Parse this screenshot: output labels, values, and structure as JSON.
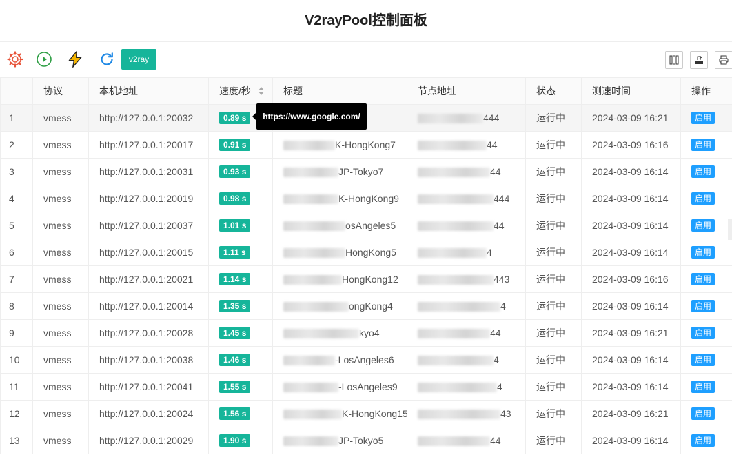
{
  "page_title": "V2rayPool控制面板",
  "toolbar": {
    "icons": [
      "gear-icon",
      "play-icon",
      "lightning-icon",
      "refresh-icon"
    ],
    "v2ray_label": "v2ray",
    "right_icons": [
      "columns-icon",
      "export-icon",
      "print-icon"
    ]
  },
  "table": {
    "headers": {
      "index": "",
      "protocol": "协议",
      "local_address": "本机地址",
      "speed": "速度/秒",
      "title": "标题",
      "node_address": "节点地址",
      "status": "状态",
      "test_time": "测速时间",
      "action": "操作"
    },
    "rows": [
      {
        "index": "1",
        "protocol": "vmess",
        "local": "http://127.0.0.1:20032",
        "speed": "0.89 s",
        "title_tail": "",
        "node_tail": "444",
        "status": "运行中",
        "time": "2024-03-09 16:21",
        "action": "启用"
      },
      {
        "index": "2",
        "protocol": "vmess",
        "local": "http://127.0.0.1:20017",
        "speed": "0.91 s",
        "title_tail": "K-HongKong7",
        "node_tail": "44",
        "status": "运行中",
        "time": "2024-03-09 16:16",
        "action": "启用"
      },
      {
        "index": "3",
        "protocol": "vmess",
        "local": "http://127.0.0.1:20031",
        "speed": "0.93 s",
        "title_tail": "JP-Tokyo7",
        "node_tail": "44",
        "status": "运行中",
        "time": "2024-03-09 16:14",
        "action": "启用"
      },
      {
        "index": "4",
        "protocol": "vmess",
        "local": "http://127.0.0.1:20019",
        "speed": "0.98 s",
        "title_tail": "K-HongKong9",
        "node_tail": "444",
        "status": "运行中",
        "time": "2024-03-09 16:14",
        "action": "启用"
      },
      {
        "index": "5",
        "protocol": "vmess",
        "local": "http://127.0.0.1:20037",
        "speed": "1.01 s",
        "title_tail": "osAngeles5",
        "node_tail": "44",
        "status": "运行中",
        "time": "2024-03-09 16:14",
        "action": "启用"
      },
      {
        "index": "6",
        "protocol": "vmess",
        "local": "http://127.0.0.1:20015",
        "speed": "1.11 s",
        "title_tail": "HongKong5",
        "node_tail": "4",
        "status": "运行中",
        "time": "2024-03-09 16:14",
        "action": "启用"
      },
      {
        "index": "7",
        "protocol": "vmess",
        "local": "http://127.0.0.1:20021",
        "speed": "1.14 s",
        "title_tail": "HongKong12",
        "node_tail": "443",
        "status": "运行中",
        "time": "2024-03-09 16:16",
        "action": "启用"
      },
      {
        "index": "8",
        "protocol": "vmess",
        "local": "http://127.0.0.1:20014",
        "speed": "1.35 s",
        "title_tail": "ongKong4",
        "node_tail": "4",
        "status": "运行中",
        "time": "2024-03-09 16:14",
        "action": "启用"
      },
      {
        "index": "9",
        "protocol": "vmess",
        "local": "http://127.0.0.1:20028",
        "speed": "1.45 s",
        "title_tail": "kyo4",
        "node_tail": "44",
        "status": "运行中",
        "time": "2024-03-09 16:21",
        "action": "启用"
      },
      {
        "index": "10",
        "protocol": "vmess",
        "local": "http://127.0.0.1:20038",
        "speed": "1.46 s",
        "title_tail": "-LosAngeles6",
        "node_tail": "4",
        "status": "运行中",
        "time": "2024-03-09 16:14",
        "action": "启用"
      },
      {
        "index": "11",
        "protocol": "vmess",
        "local": "http://127.0.0.1:20041",
        "speed": "1.55 s",
        "title_tail": "-LosAngeles9",
        "node_tail": "4",
        "status": "运行中",
        "time": "2024-03-09 16:14",
        "action": "启用"
      },
      {
        "index": "12",
        "protocol": "vmess",
        "local": "http://127.0.0.1:20024",
        "speed": "1.56 s",
        "title_tail": "K-HongKong15",
        "node_tail": "43",
        "status": "运行中",
        "time": "2024-03-09 16:21",
        "action": "启用"
      },
      {
        "index": "13",
        "protocol": "vmess",
        "local": "http://127.0.0.1:20029",
        "speed": "1.90 s",
        "title_tail": "JP-Tokyo5",
        "node_tail": "44",
        "status": "运行中",
        "time": "2024-03-09 16:14",
        "action": "启用"
      }
    ]
  },
  "tooltip": {
    "text": "https://www.google.com/"
  },
  "colors": {
    "accent": "#16b59a",
    "tag": "#1e9fff",
    "gear": "#e8543a",
    "play": "#2e9e44",
    "lightning": "#f4b400",
    "refresh": "#1e88e5"
  }
}
